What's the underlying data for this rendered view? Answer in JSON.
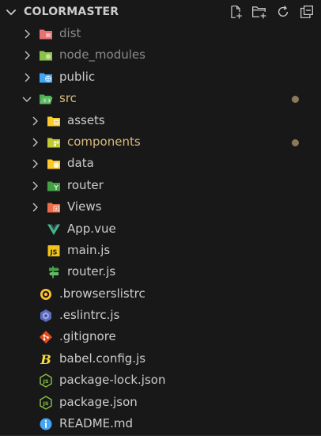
{
  "explorer": {
    "title": "COLORMASTER",
    "actions": [
      {
        "icon": "new-file-icon"
      },
      {
        "icon": "new-folder-icon"
      },
      {
        "icon": "refresh-icon"
      },
      {
        "icon": "collapse-all-icon"
      }
    ]
  },
  "tree": [
    {
      "id": "dist",
      "label": "dist",
      "type": "folder",
      "expanded": false,
      "color": "#8b8b8b",
      "icon_color": "#e57373"
    },
    {
      "id": "node_modules",
      "label": "node_modules",
      "type": "folder",
      "expanded": false,
      "color": "#8b8b8b",
      "icon_color": "#8bc34a"
    },
    {
      "id": "public",
      "label": "public",
      "type": "folder",
      "expanded": false,
      "color": "#cccccc",
      "icon_color": "#42a5f5"
    },
    {
      "id": "src",
      "label": "src",
      "type": "folder",
      "expanded": true,
      "color": "#d7ba7d",
      "icon_color": "#66bb6a",
      "modified": true
    },
    {
      "id": "assets",
      "label": "assets",
      "type": "folder",
      "expanded": false,
      "color": "#cccccc",
      "icon_color": "#ffca28"
    },
    {
      "id": "components",
      "label": "components",
      "type": "folder",
      "expanded": false,
      "color": "#d7ba7d",
      "icon_color": "#c0ca33",
      "modified": true
    },
    {
      "id": "data",
      "label": "data",
      "type": "folder",
      "expanded": false,
      "color": "#cccccc",
      "icon_color": "#ffca28"
    },
    {
      "id": "router",
      "label": "router",
      "type": "folder",
      "expanded": false,
      "color": "#cccccc",
      "icon_color": "#43a047"
    },
    {
      "id": "views",
      "label": "Views",
      "type": "folder",
      "expanded": false,
      "color": "#cccccc",
      "icon_color": "#ef6c4a"
    },
    {
      "id": "app_vue",
      "label": "App.vue",
      "type": "file",
      "color": "#cccccc",
      "icon": "vue-icon",
      "icon_color": "#41b883"
    },
    {
      "id": "main_js",
      "label": "main.js",
      "type": "file",
      "color": "#cccccc",
      "icon": "js-icon",
      "icon_color": "#f0c419"
    },
    {
      "id": "router_js",
      "label": "router.js",
      "type": "file",
      "color": "#cccccc",
      "icon": "router-sign-icon",
      "icon_color": "#43a047"
    },
    {
      "id": "browserslistrc",
      "label": ".browserslistrc",
      "type": "file",
      "color": "#cccccc",
      "icon": "browserslist-icon",
      "icon_color": "#fbc02d"
    },
    {
      "id": "eslintrc",
      "label": ".eslintrc.js",
      "type": "file",
      "color": "#cccccc",
      "icon": "eslint-icon",
      "icon_color": "#7e57c2"
    },
    {
      "id": "gitignore",
      "label": ".gitignore",
      "type": "file",
      "color": "#cccccc",
      "icon": "git-icon",
      "icon_color": "#e64a19"
    },
    {
      "id": "babel",
      "label": "babel.config.js",
      "type": "file",
      "color": "#cccccc",
      "icon": "babel-icon",
      "icon_color": "#f9dc3e"
    },
    {
      "id": "package_lock",
      "label": "package-lock.json",
      "type": "file",
      "color": "#cccccc",
      "icon": "nodejs-icon",
      "icon_color": "#8bc34a"
    },
    {
      "id": "package",
      "label": "package.json",
      "type": "file",
      "color": "#cccccc",
      "icon": "nodejs-icon",
      "icon_color": "#8bc34a"
    },
    {
      "id": "readme",
      "label": "README.md",
      "type": "file",
      "color": "#cccccc",
      "icon": "info-icon",
      "icon_color": "#42a5f5"
    }
  ]
}
